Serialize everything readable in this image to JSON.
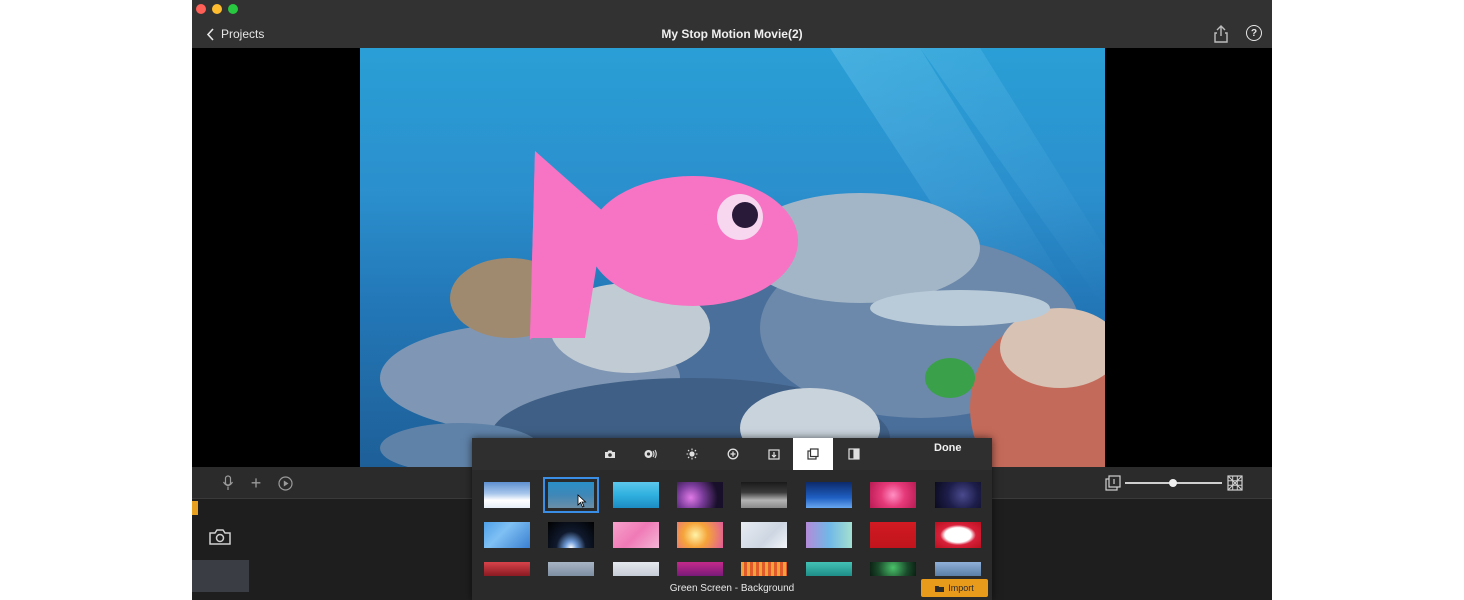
{
  "window": {
    "title": "My Stop Motion Movie(2)",
    "back_label": "Projects"
  },
  "panel": {
    "done_label": "Done",
    "category_label": "Green Screen - Background",
    "import_label": "Import",
    "selected_tool": "green-screen-background",
    "tools": [
      "camera-icon",
      "remote-key-icon",
      "brightness-icon",
      "zoom-icon",
      "import-frame-icon",
      "background-icon",
      "split-screen-icon"
    ],
    "selected_thumbnail": 1
  },
  "colors": {
    "titlebar": "#323232",
    "accent": "#3a8ee6",
    "import": "#e89b1a",
    "fish": "#f774c4"
  }
}
